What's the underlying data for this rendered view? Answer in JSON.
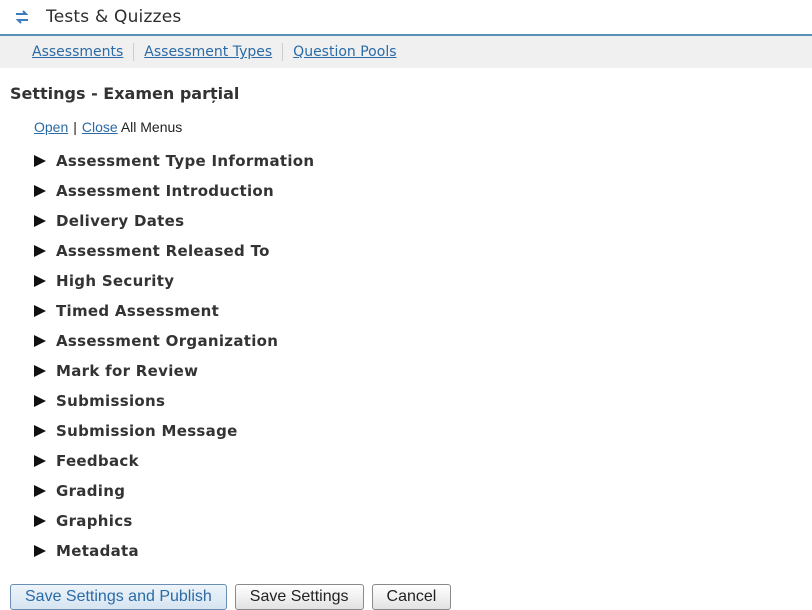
{
  "tool": {
    "title": "Tests & Quizzes",
    "icon": "swap-arrows-icon",
    "icon_color": "#3b7bbf"
  },
  "nav": {
    "items": [
      {
        "label": "Assessments"
      },
      {
        "label": "Assessment Types"
      },
      {
        "label": "Question Pools"
      }
    ]
  },
  "page": {
    "title": "Settings - Examen parțial"
  },
  "toggle": {
    "open": "Open",
    "separator": "|",
    "close": "Close",
    "suffix": "All Menus"
  },
  "sections": [
    {
      "label": "Assessment Type Information"
    },
    {
      "label": "Assessment Introduction"
    },
    {
      "label": "Delivery Dates"
    },
    {
      "label": "Assessment Released To"
    },
    {
      "label": "High Security"
    },
    {
      "label": "Timed Assessment"
    },
    {
      "label": "Assessment Organization"
    },
    {
      "label": "Mark for Review"
    },
    {
      "label": "Submissions"
    },
    {
      "label": "Submission Message"
    },
    {
      "label": "Feedback"
    },
    {
      "label": "Grading"
    },
    {
      "label": "Graphics"
    },
    {
      "label": "Metadata"
    }
  ],
  "buttons": {
    "save_publish": "Save Settings and Publish",
    "save": "Save Settings",
    "cancel": "Cancel"
  },
  "colors": {
    "link": "#2a6aa6",
    "header_rule": "#5a8fb8",
    "nav_bg": "#f0f0f0"
  }
}
